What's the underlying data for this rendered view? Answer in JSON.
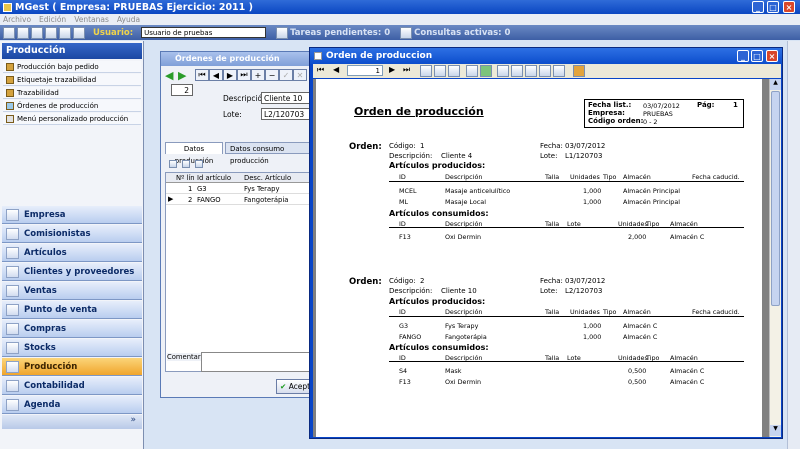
{
  "window": {
    "title": "MGest ( Empresa: PRUEBAS Ejercicio: 2011 )"
  },
  "menu": [
    "Archivo",
    "Edición",
    "Ventanas",
    "Ayuda"
  ],
  "toolbar": {
    "user_label": "Usuario:",
    "user_value": "Usuario de pruebas",
    "tareas": "Tareas pendientes: 0",
    "consultas": "Consultas activas: 0"
  },
  "sidebar": {
    "header": "Producción",
    "items": [
      "Producción bajo pedido",
      "Etiquetaje trazabilidad",
      "Trazabilidad",
      "Órdenes de producción",
      "Menú personalizado producción"
    ],
    "categories": [
      "Empresa",
      "Comisionistas",
      "Artículos",
      "Clientes y proveedores",
      "Ventas",
      "Punto de venta",
      "Compras",
      "Stocks",
      "Producción",
      "Contabilidad",
      "Agenda"
    ]
  },
  "ordenes": {
    "title": "Órdenes de producción",
    "record": "2",
    "desc_label": "Descripción:",
    "desc_value": "Cliente 10",
    "lote_label": "Lote:",
    "lote_value": "L2/120703",
    "tabs": [
      "Datos producción",
      "Datos consumo producción"
    ],
    "grid_headers": [
      "Nº lín",
      "Id artículo",
      "Desc. Artículo"
    ],
    "rows": [
      {
        "n": "1",
        "id": "G3",
        "desc": "Fys Terapy"
      },
      {
        "n": "2",
        "id": "FANGO",
        "desc": "Fangoterápia"
      }
    ],
    "comentario_label": "Comentario:",
    "accept": "Acept"
  },
  "report": {
    "window_title": "Orden de produccion",
    "page_input": "1",
    "title": "Orden de producción",
    "head_labels": [
      "Fecha list.:",
      "Empresa:",
      "Código orden:"
    ],
    "head_values": [
      "03/07/2012",
      "PRUEBAS",
      "0 - 2"
    ],
    "page_label": "Pág:",
    "page_value": "1",
    "orden_label": "Orden:",
    "codigo_label": "Código:",
    "descripcion_label": "Descripción:",
    "fecha_label": "Fecha:",
    "lote_label": "Lote:",
    "prod_label": "Artículos producidos:",
    "cons_label": "Artículos consumidos:",
    "prod_cols": [
      "ID",
      "Descripción",
      "Talla",
      "Unidades",
      "Tipo",
      "Almacén",
      "Fecha caducid."
    ],
    "cons_cols": [
      "ID",
      "Descripción",
      "Talla",
      "Lote",
      "Unidades",
      "Tipo",
      "Almacén"
    ],
    "orders": [
      {
        "codigo": "1",
        "cliente": "Cliente 4",
        "fecha": "03/07/2012",
        "lote": "L1/120703",
        "prod": [
          {
            "id": "MCEL",
            "desc": "Masaje anticelulítico",
            "uds": "1,000",
            "alm": "Almacén Principal"
          },
          {
            "id": "ML",
            "desc": "Masaje Local",
            "uds": "1,000",
            "alm": "Almacén Principal"
          }
        ],
        "cons": [
          {
            "id": "F13",
            "desc": "Oxi Dermin",
            "uds": "2,000",
            "alm": "Almacén C"
          }
        ]
      },
      {
        "codigo": "2",
        "cliente": "Cliente 10",
        "fecha": "03/07/2012",
        "lote": "L2/120703",
        "prod": [
          {
            "id": "G3",
            "desc": "Fys Terapy",
            "uds": "1,000",
            "alm": "Almacén C"
          },
          {
            "id": "FANGO",
            "desc": "Fangoterápia",
            "uds": "1,000",
            "alm": "Almacén C"
          }
        ],
        "cons": [
          {
            "id": "S4",
            "desc": "Mask",
            "uds": "0,500",
            "alm": "Almacén C"
          },
          {
            "id": "F13",
            "desc": "Oxi Dermin",
            "uds": "0,500",
            "alm": "Almacén C"
          }
        ]
      }
    ]
  }
}
